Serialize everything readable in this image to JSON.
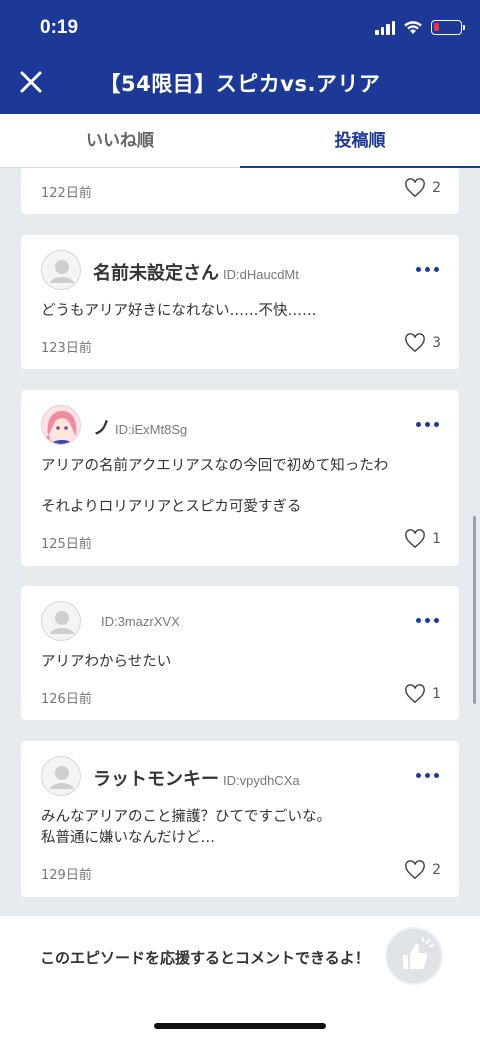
{
  "status_bar": {
    "time": "0:19"
  },
  "header": {
    "title": "【54限目】スピカvs.アリア"
  },
  "tabs": [
    {
      "label": "いいね順",
      "active": false
    },
    {
      "label": "投稿順",
      "active": true
    }
  ],
  "comments": [
    {
      "date": "122日前",
      "likes": "2"
    },
    {
      "username": "名前未設定さん",
      "user_id": "ID:dHaucdMt",
      "text": "どうもアリア好きになれない……不快……",
      "date": "123日前",
      "likes": "3",
      "avatar": "default-avatar"
    },
    {
      "username": "ノ",
      "user_id": "ID:iExMt8Sg",
      "text_line1": "アリアの名前アクエリアスなの今回で初めて知ったわ",
      "text_line2": "それよりロリアリアとスピカ可愛すぎる",
      "date": "125日前",
      "likes": "1",
      "avatar": "anime-girl-avatar"
    },
    {
      "username": "",
      "user_id": "ID:3mazrXVX",
      "text": "アリアわからせたい",
      "date": "126日前",
      "likes": "1",
      "avatar": "default-avatar"
    },
    {
      "username": "ラットモンキー",
      "user_id": "ID:vpydhCXa",
      "text_line1": "みんなアリアのこと擁護？ひてですごいな。",
      "text_line2": "私普通に嫌いなんだけど…",
      "date": "129日前",
      "likes": "2",
      "avatar": "default-avatar"
    }
  ],
  "footer": {
    "prompt": "このエピソードを応援するとコメントできるよ！",
    "button_icon": "thumbs-up-icon"
  },
  "colors": {
    "brand": "#1d3997",
    "background": "#e5ebef",
    "battery_low": "#e23b3b"
  }
}
